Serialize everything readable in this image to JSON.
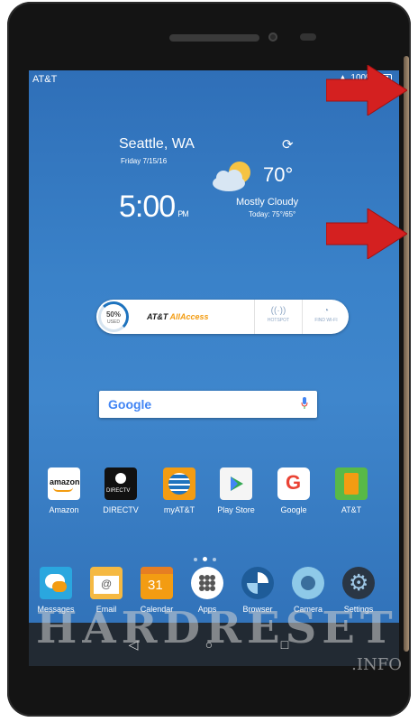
{
  "status_bar": {
    "carrier": "AT&T",
    "battery": "100%"
  },
  "weather": {
    "city": "Seattle, WA",
    "date": "Friday 7/15/16",
    "time": "5:00",
    "ampm": "PM",
    "temperature": "70°",
    "condition": "Mostly Cloudy",
    "today_range": "Today: 75°/65°",
    "icon": "partly-cloudy-icon"
  },
  "allaccess_widget": {
    "usage_percent": "50%",
    "usage_label": "USED",
    "brand": "AT&T",
    "product": "AllAccess",
    "hotspot_label": "HOTSPOT",
    "wifi_label": "FIND WI-FI"
  },
  "search_bar": {
    "logo": "Google",
    "icon": "mic-icon"
  },
  "apps_row1": [
    {
      "label": "Amazon",
      "icon": "amazon-icon"
    },
    {
      "label": "DIRECTV",
      "icon": "directv-icon"
    },
    {
      "label": "myAT&T",
      "icon": "att-globe-icon"
    },
    {
      "label": "Play Store",
      "icon": "play-store-icon"
    },
    {
      "label": "Google",
      "icon": "google-icon"
    },
    {
      "label": "AT&T",
      "icon": "att-icon"
    }
  ],
  "apps_dock": [
    {
      "label": "Messages",
      "icon": "messages-icon"
    },
    {
      "label": "Email",
      "icon": "email-icon"
    },
    {
      "label": "Calendar",
      "icon": "calendar-icon",
      "day": "31"
    },
    {
      "label": "Apps",
      "icon": "apps-icon"
    },
    {
      "label": "Browser",
      "icon": "browser-icon"
    },
    {
      "label": "Camera",
      "icon": "camera-icon"
    },
    {
      "label": "Settings",
      "icon": "settings-icon"
    }
  ],
  "amazon_text": "amazon",
  "directv_text": "DIRECTV",
  "watermark": {
    "main": "HARDRESET",
    "suffix": ".INFO"
  },
  "colors": {
    "screen_bg": "#3a82c9",
    "arrow": "#d42020",
    "navbar": "#222a33"
  }
}
